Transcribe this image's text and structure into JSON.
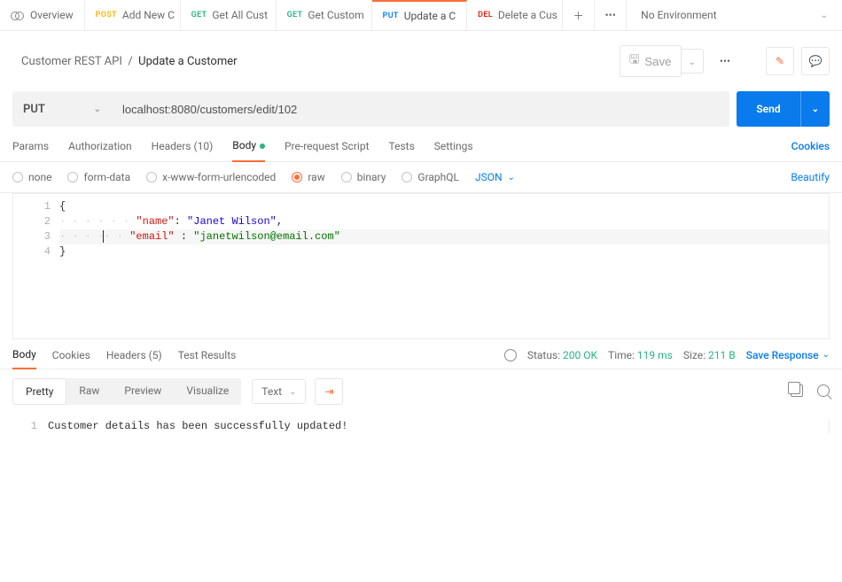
{
  "tabs": {
    "overview": "Overview",
    "items": [
      {
        "method": "POST",
        "mclass": "m-post",
        "label": "Add New C"
      },
      {
        "method": "GET",
        "mclass": "m-get",
        "label": "Get All Cust"
      },
      {
        "method": "GET",
        "mclass": "m-get",
        "label": "Get Custom"
      },
      {
        "method": "PUT",
        "mclass": "m-put",
        "label": "Update a C"
      },
      {
        "method": "DEL",
        "mclass": "m-del",
        "label": "Delete a Cus"
      }
    ],
    "environment": "No Environment"
  },
  "breadcrumb": {
    "collection": "Customer REST API",
    "sep": "/",
    "item": "Update a Customer",
    "save": "Save"
  },
  "request": {
    "method": "PUT",
    "url": "localhost:8080/customers/edit/102",
    "send": "Send"
  },
  "req_tabs": {
    "params": "Params",
    "auth": "Authorization",
    "headers": "Headers (10)",
    "body": "Body",
    "prereq": "Pre-request Script",
    "tests": "Tests",
    "settings": "Settings",
    "cookies": "Cookies"
  },
  "body_types": {
    "none": "none",
    "form": "form-data",
    "xform": "x-www-form-urlencoded",
    "raw": "raw",
    "binary": "binary",
    "graphql": "GraphQL",
    "json": "JSON",
    "beautify": "Beautify"
  },
  "editor": {
    "key_name": "\"name\"",
    "val_name": "\"Janet Wilson\"",
    "key_email": "\"email\"",
    "val_email": "\"janetwilson@email.com\""
  },
  "response": {
    "tabs": {
      "body": "Body",
      "cookies": "Cookies",
      "headers": "Headers (5)",
      "tests": "Test Results"
    },
    "status_l": "Status:",
    "status_v": "200 OK",
    "time_l": "Time:",
    "time_v": "119 ms",
    "size_l": "Size:",
    "size_v": "211 B",
    "save": "Save Response",
    "views": {
      "pretty": "Pretty",
      "raw": "Raw",
      "preview": "Preview",
      "visualize": "Visualize"
    },
    "format": "Text",
    "line1": "Customer details has been successfully updated!"
  }
}
